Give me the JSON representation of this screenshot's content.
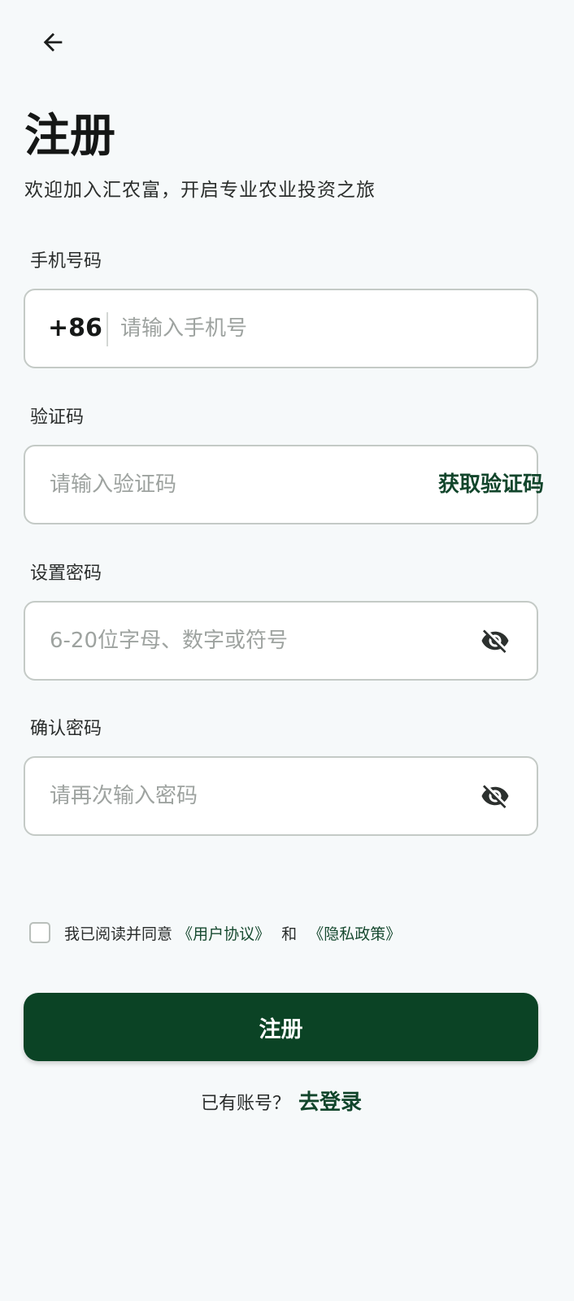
{
  "header": {
    "back_icon": "arrow-left-icon",
    "title": "注册",
    "subtitle": "欢迎加入汇农富，开启专业农业投资之旅"
  },
  "form": {
    "phone": {
      "label": "手机号码",
      "country_code": "+86",
      "placeholder": "请输入手机号",
      "value": ""
    },
    "code": {
      "label": "验证码",
      "placeholder": "请输入验证码",
      "value": "",
      "get_code_label": "获取验证码"
    },
    "password": {
      "label": "设置密码",
      "placeholder": "6-20位字母、数字或符号",
      "value": "",
      "toggle_icon": "eye-off-icon"
    },
    "confirm_password": {
      "label": "确认密码",
      "placeholder": "请再次输入密码",
      "value": "",
      "toggle_icon": "eye-off-icon"
    }
  },
  "agreement": {
    "checked": false,
    "prefix": "我已阅读并同意",
    "user_agreement": "《用户协议》",
    "and": "和",
    "privacy_policy": "《隐私政策》"
  },
  "actions": {
    "submit_label": "注册",
    "login_prompt": "已有账号？",
    "login_link": "去登录"
  },
  "colors": {
    "background": "#f6f9fa",
    "primary": "#0b4325",
    "link": "#11452b",
    "placeholder": "#9ea3a0",
    "border": "#c4cac6"
  }
}
